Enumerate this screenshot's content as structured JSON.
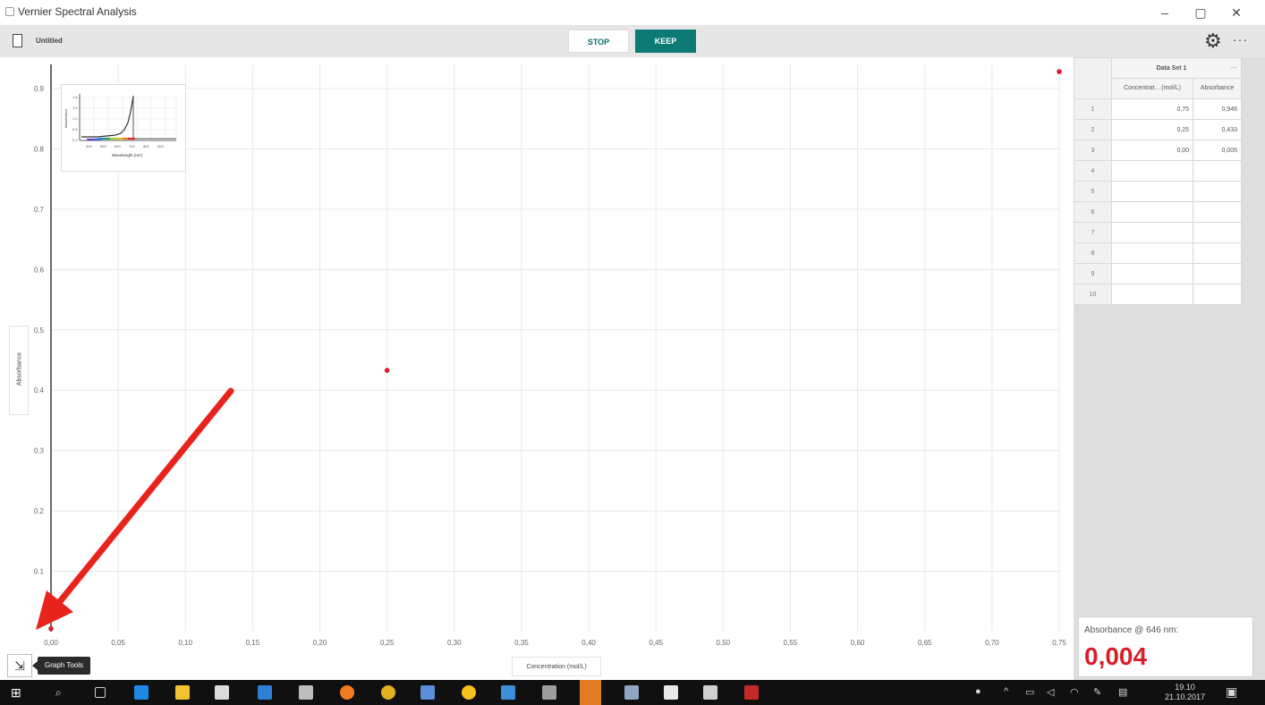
{
  "window": {
    "title": "Vernier Spectral Analysis",
    "minimize": "–",
    "maximize": "▢",
    "close": "✕"
  },
  "toolbar": {
    "file_name": "Untitled",
    "stop_label": "STOP",
    "keep_label": "KEEP",
    "more": "···"
  },
  "graph": {
    "x_axis_label": "Concentration (mol/L)",
    "y_axis_label": "Absorbance",
    "graph_tools_label": "Graph Tools"
  },
  "mini_graph": {
    "x_label": "Wavelength (nm)",
    "y_label": "Absorbance",
    "x_ticks": [
      "400",
      "500",
      "600",
      "700",
      "800",
      "900"
    ],
    "y_ticks": [
      "1.8",
      "1.5",
      "1.0",
      "0.5",
      "0.2"
    ]
  },
  "chart_data": {
    "type": "scatter",
    "x_ticks": [
      "0,00",
      "0,05",
      "0,10",
      "0,15",
      "0,20",
      "0,25",
      "0,30",
      "0,35",
      "0,40",
      "0,45",
      "0,50",
      "0,55",
      "0,60",
      "0,65",
      "0,70",
      "0,75"
    ],
    "y_ticks": [
      "0.9",
      "0.8",
      "0.7",
      "0.6",
      "0.5",
      "0.4",
      "0.3",
      "0.2",
      "0.1"
    ],
    "xlim": [
      0,
      0.75
    ],
    "ylim": [
      0,
      0.94
    ],
    "grid": true,
    "points": [
      {
        "x": 0.75,
        "y": 0.928
      },
      {
        "x": 0.25,
        "y": 0.433
      },
      {
        "x": 0.0,
        "y": 0.005
      }
    ],
    "point_color": "#d71f2b"
  },
  "data_table": {
    "title": "Data Set 1",
    "more": "···",
    "columns": [
      {
        "label": "Concentrat... (mol/L)"
      },
      {
        "label": "Absorbance"
      }
    ],
    "rows": [
      {
        "index": "1",
        "concentration": "0,75",
        "absorbance": "0,946"
      },
      {
        "index": "2",
        "concentration": "0,25",
        "absorbance": "0,433"
      },
      {
        "index": "3",
        "concentration": "0,00",
        "absorbance": "0,005"
      },
      {
        "index": "4",
        "concentration": "",
        "absorbance": ""
      },
      {
        "index": "5",
        "concentration": "",
        "absorbance": ""
      },
      {
        "index": "6",
        "concentration": "",
        "absorbance": ""
      },
      {
        "index": "7",
        "concentration": "",
        "absorbance": ""
      },
      {
        "index": "8",
        "concentration": "",
        "absorbance": ""
      },
      {
        "index": "9",
        "concentration": "",
        "absorbance": ""
      },
      {
        "index": "10",
        "concentration": "",
        "absorbance": ""
      }
    ]
  },
  "meter": {
    "label": "Absorbance @ 646 nm:",
    "value": "0,004",
    "color": "#d71f2b"
  },
  "taskbar": {
    "time": "19.10",
    "date": "21.10.2017"
  },
  "colors": {
    "accent": "#0d7a75",
    "point": "#d71f2b",
    "arrow": "#e8231c"
  }
}
